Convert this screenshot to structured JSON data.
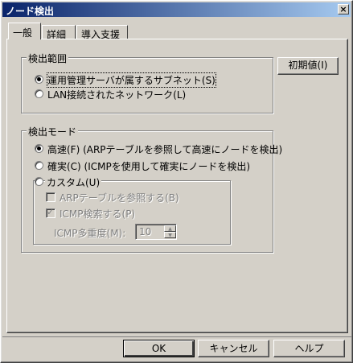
{
  "window": {
    "title": "ノード検出",
    "close_glyph": "×"
  },
  "tabs": [
    {
      "label": "一般",
      "active": true
    },
    {
      "label": "詳細",
      "active": false
    },
    {
      "label": "導入支援",
      "active": false
    }
  ],
  "range_group": {
    "label": "検出範囲",
    "options": [
      {
        "label": "運用管理サーバが属するサブネット(S)",
        "selected": true
      },
      {
        "label": "LAN接続されたネットワーク(L)",
        "selected": false
      }
    ]
  },
  "reset_button": {
    "label": "初期値(I)"
  },
  "mode_group": {
    "label": "検出モード",
    "options": [
      {
        "label": "高速(F)  (ARPテーブルを参照して高速にノードを検出)",
        "selected": true
      },
      {
        "label": "確実(C)  (ICMPを使用して確実にノードを検出)",
        "selected": false
      },
      {
        "label": "カスタム(U)",
        "selected": false
      }
    ],
    "custom": {
      "arp_check": {
        "label": "ARPテーブルを参照する(B)",
        "checked": false
      },
      "icmp_check": {
        "label": "ICMP検索する(P)",
        "checked": true
      },
      "multiplicity": {
        "label": "ICMP多重度(M):",
        "value": "10"
      }
    }
  },
  "buttons": {
    "ok": "OK",
    "cancel": "キャンセル",
    "help": "ヘルプ"
  }
}
